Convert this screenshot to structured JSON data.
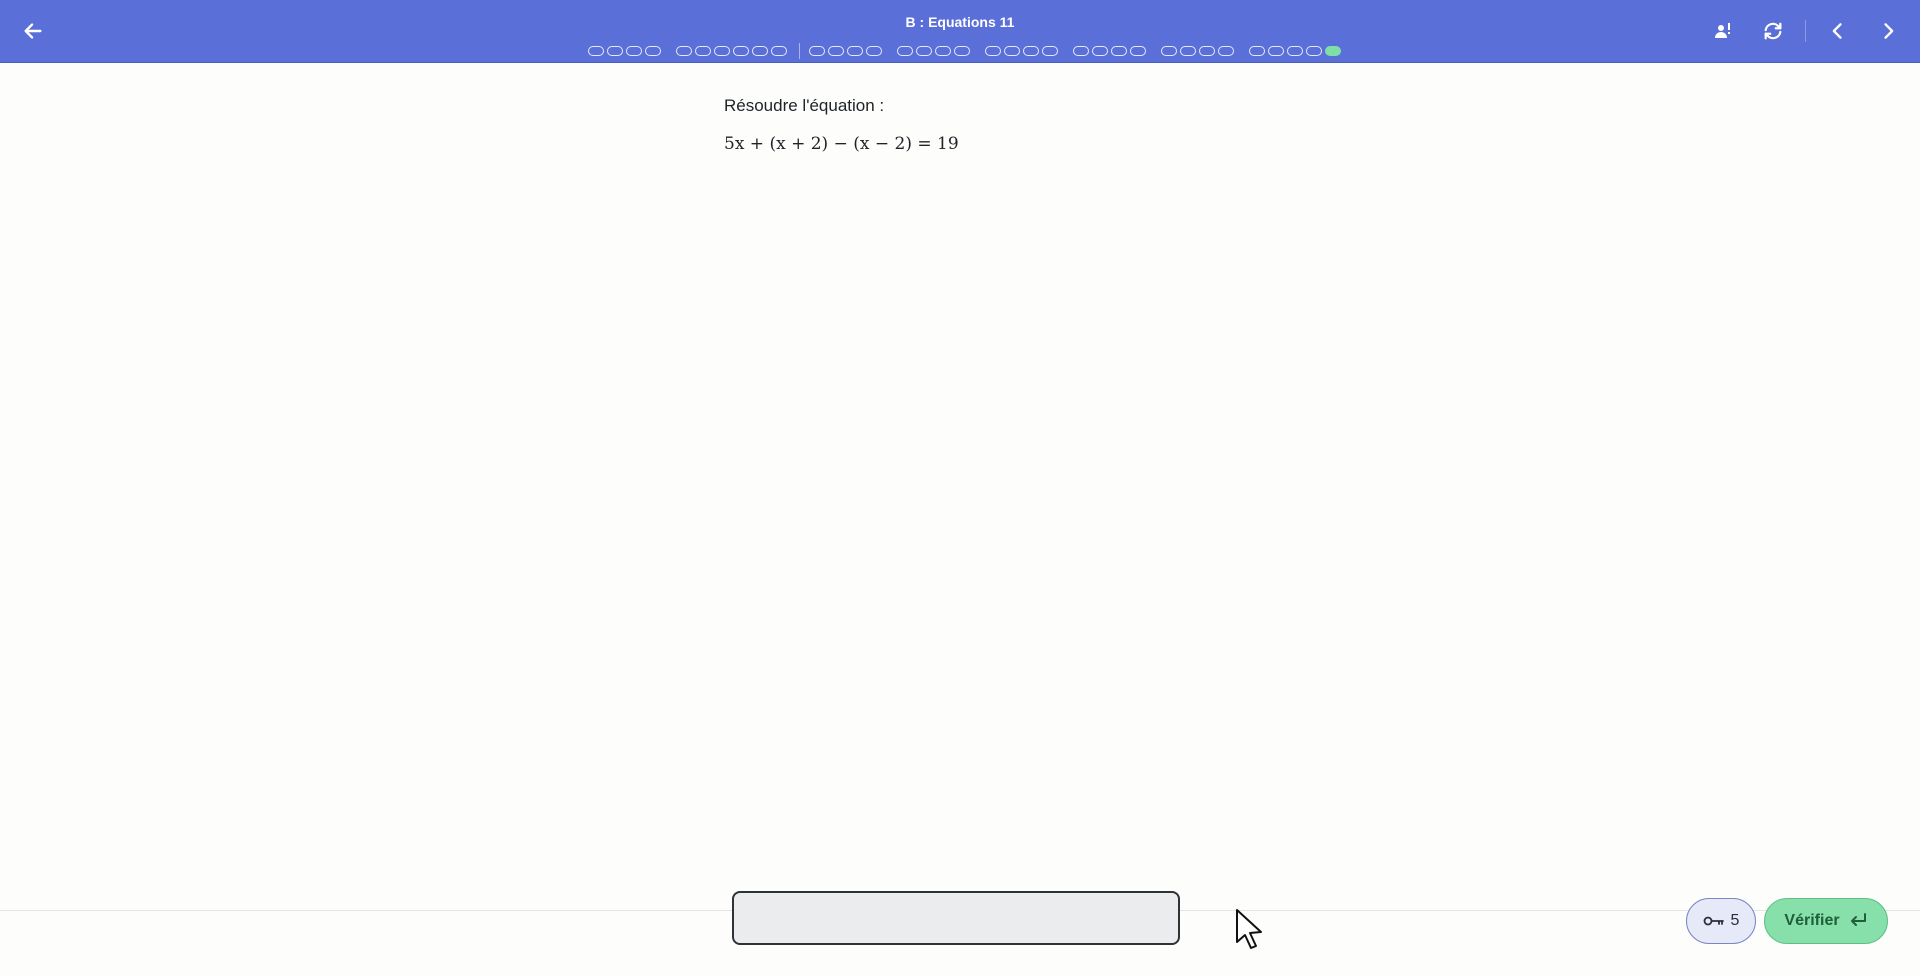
{
  "header": {
    "title": "B : Equations 11",
    "progress_groups": [
      {
        "dots": 4,
        "completed": 0
      },
      {
        "dots": 6,
        "completed": 0,
        "divider_after": true
      },
      {
        "dots": 4,
        "completed": 0
      },
      {
        "dots": 4,
        "completed": 0
      },
      {
        "dots": 4,
        "completed": 0
      },
      {
        "dots": 4,
        "completed": 0
      },
      {
        "dots": 4,
        "completed": 0
      },
      {
        "dots": 4,
        "completed": 1
      }
    ],
    "icons": [
      "arrow-left-icon",
      "student-alert-icon",
      "refresh-icon",
      "chevron-left-icon",
      "chevron-right-icon"
    ]
  },
  "exercise": {
    "instruction": "Résoudre l'équation :",
    "equation": "5x + (x + 2) − (x − 2) = 19"
  },
  "footer": {
    "answer_value": "",
    "hint_count": "5",
    "verify_label": "Vérifier"
  },
  "colors": {
    "header_bg": "#5b6fd8",
    "done_dot": "#7ee0a7",
    "verify_bg": "#87e0a9"
  }
}
